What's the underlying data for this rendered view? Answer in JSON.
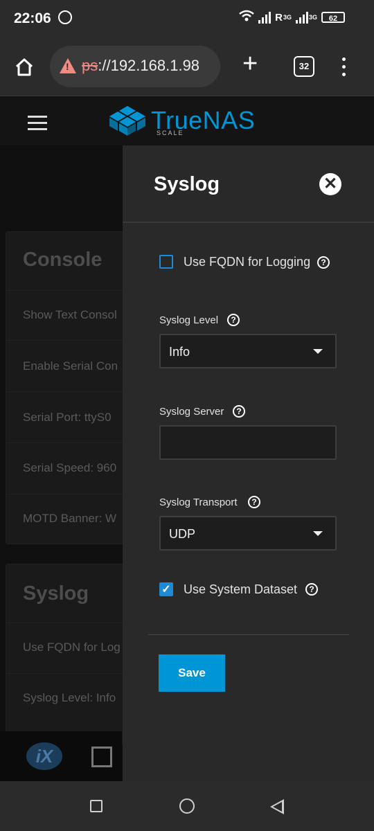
{
  "status_bar": {
    "time": "22:06",
    "network_r": "R",
    "network_3g_a": "3G",
    "network_3g_b": "3G",
    "battery": "62"
  },
  "browser": {
    "url_prefix_struck": "ps",
    "url_rest": "://192.168.1.98",
    "tab_count": "32"
  },
  "app": {
    "logo_word": "TrueNAS",
    "logo_sub": "SCALE",
    "brand_color": "#0095d5"
  },
  "background": {
    "console": {
      "title": "Console",
      "rows": [
        "Show Text Consol",
        "Enable Serial Con",
        "Serial Port:  ttyS0",
        "Serial Speed:  960",
        "MOTD Banner:  W"
      ]
    },
    "syslog": {
      "title": "Syslog",
      "rows": [
        "Use FQDN for Log",
        "Syslog Level:  Info"
      ]
    },
    "footer_logo": "iX"
  },
  "panel": {
    "title": "Syslog",
    "fqdn_label": "Use FQDN for Logging",
    "fqdn_checked": false,
    "level_label": "Syslog Level",
    "level_value": "Info",
    "server_label": "Syslog Server",
    "server_value": "",
    "transport_label": "Syslog Transport",
    "transport_value": "UDP",
    "dataset_label": "Use System Dataset",
    "dataset_checked": true,
    "check_glyph": "✓",
    "help_glyph": "?",
    "close_glyph": "✕",
    "save_label": "Save"
  }
}
